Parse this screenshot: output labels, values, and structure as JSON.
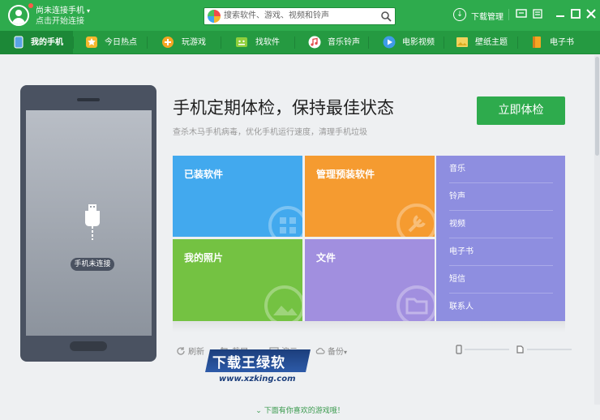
{
  "window": {
    "user_name": "尚未连接手机",
    "user_sub": "点击开始连接",
    "search_placeholder": "搜索软件、游戏、视频和铃声",
    "download_manager": "下载管理"
  },
  "nav": {
    "items": [
      {
        "label": "我的手机",
        "icon": "phone-icon",
        "active": true
      },
      {
        "label": "今日热点",
        "icon": "star-icon"
      },
      {
        "label": "玩游戏",
        "icon": "gamepad-icon"
      },
      {
        "label": "找软件",
        "icon": "android-icon"
      },
      {
        "label": "音乐铃声",
        "icon": "music-icon"
      },
      {
        "label": "电影视频",
        "icon": "play-icon"
      },
      {
        "label": "壁纸主题",
        "icon": "wallpaper-icon"
      },
      {
        "label": "电子书",
        "icon": "book-icon"
      }
    ]
  },
  "phone": {
    "status": "手机未连接"
  },
  "main": {
    "headline": "手机定期体检，保持最佳状态",
    "subline": "查杀木马手机病毒，优化手机运行速度，清理手机垃圾",
    "check_button": "立即体检"
  },
  "tiles": [
    {
      "label": "已装软件",
      "color": "#42a9ee"
    },
    {
      "label": "管理预装软件",
      "color": "#f59b30"
    },
    {
      "label": "我的照片",
      "color": "#74c242"
    },
    {
      "label": "文件",
      "color": "#a18fdf"
    }
  ],
  "side_list": [
    "音乐",
    "铃声",
    "视频",
    "电子书",
    "短信",
    "联系人"
  ],
  "toolbar": {
    "refresh": "刷新",
    "screenshot": "截屏",
    "demo": "演示",
    "backup": "备份"
  },
  "watermark": {
    "title": "下载王绿软",
    "url": "www.xzking.com"
  },
  "bottom_tip": "下面有你喜欢的游戏哦！",
  "colors": {
    "brand_green": "#2eab4d",
    "side_purple": "#8e8ee0"
  }
}
